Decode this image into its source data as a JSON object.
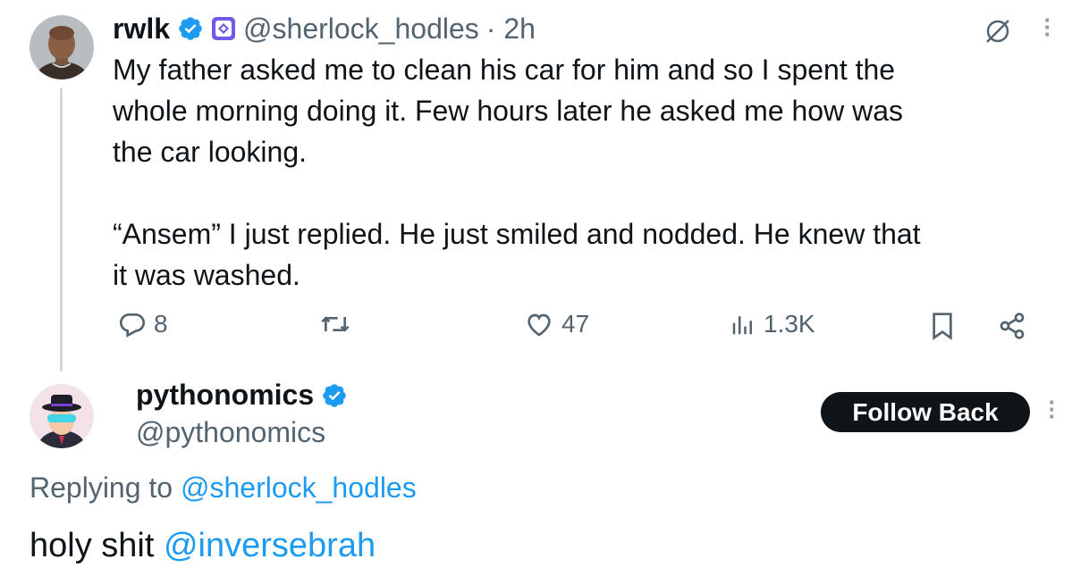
{
  "tweet": {
    "author_name": "rwlk",
    "handle": "@sherlock_hodles",
    "time": "· 2h",
    "body_lines": [
      "My father asked me to clean his car for him and so I spent the",
      "whole morning doing it. Few hours later he asked me how was",
      "the car looking.",
      "“Ansem” I just replied. He just smiled and nodded. He knew that",
      "it was washed."
    ],
    "stats": {
      "replies": "8",
      "likes": "47",
      "views": "1.3K"
    }
  },
  "reply": {
    "author_name": "pythonomics",
    "handle": "@pythonomics",
    "follow_label": "Follow Back",
    "replying_prefix": "Replying to",
    "replying_handle": "@sherlock_hodles",
    "text_prefix": "holy shit",
    "text_mention": "@inversebrah"
  },
  "colors": {
    "text": "#0f1419",
    "secondary": "#536471",
    "link": "#1d9bf0",
    "verified": "#1d9bf0",
    "affiliate_badge": "#6c5ce7"
  },
  "icons": [
    "verified-icon",
    "affiliate-badge-icon",
    "reply-icon",
    "retweet-icon",
    "like-icon",
    "views-icon",
    "bookmark-icon",
    "share-icon",
    "grok-icon",
    "more-icon"
  ]
}
